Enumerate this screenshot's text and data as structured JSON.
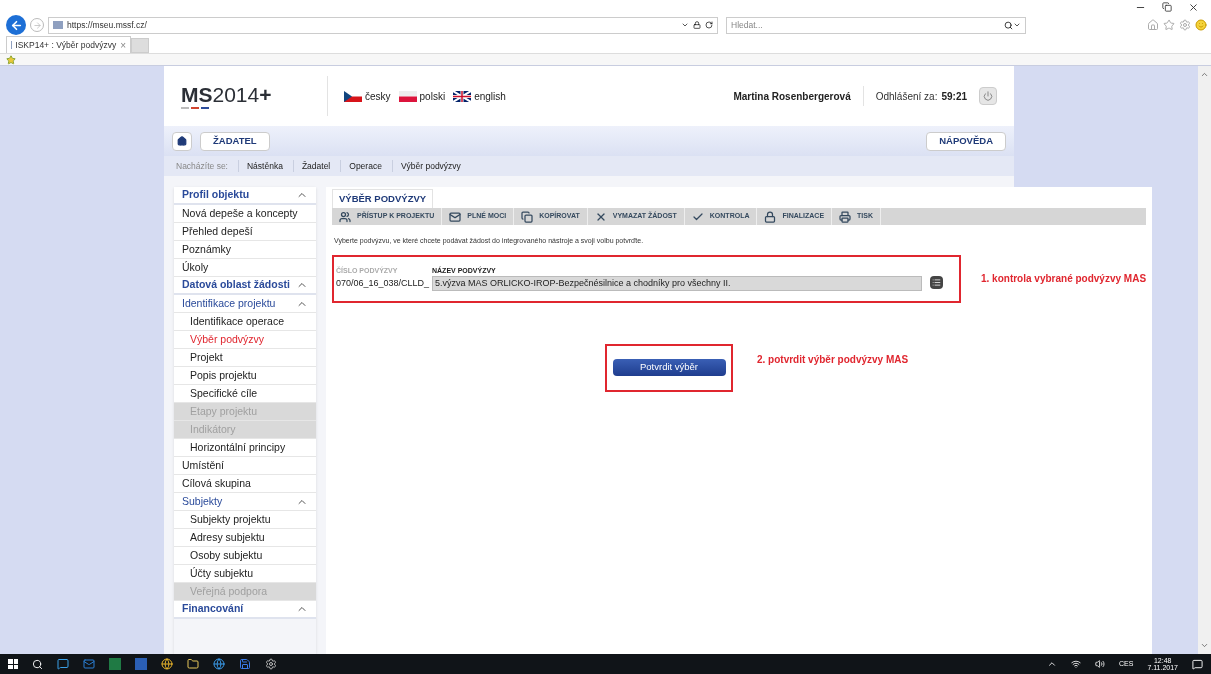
{
  "browser": {
    "url": "https://mseu.mssf.cz/",
    "search_placeholder": "Hledat...",
    "tabs": [
      {
        "title": "ISKP14+ : Výběr podvýzvy",
        "close": "×",
        "selected": true
      }
    ]
  },
  "header": {
    "logo_main": "MS",
    "logo_year": "2014",
    "logo_plus": "+",
    "languages": [
      {
        "label": "česky"
      },
      {
        "label": "polski"
      },
      {
        "label": "english"
      }
    ],
    "user": "Martina Rosenbergerová",
    "logout_label": "Odhlášení za:",
    "logout_time": "59:21"
  },
  "nav": {
    "role": "ŽADATEL",
    "help": "NÁPOVĚDA"
  },
  "breadcrumb": {
    "label": "Nacházíte se:",
    "items": [
      "Nástěnka",
      "Žadatel",
      "Operace",
      "Výběr podvýzvy"
    ]
  },
  "sidebar": [
    {
      "label": "Profil objektu",
      "expanded": true,
      "children": [
        {
          "label": "Nová depeše a koncepty",
          "selected": false,
          "disabled": false
        },
        {
          "label": "Přehled depeší",
          "selected": false,
          "disabled": false
        },
        {
          "label": "Poznámky",
          "selected": false,
          "disabled": false
        },
        {
          "label": "Úkoly",
          "selected": false,
          "disabled": false
        }
      ]
    },
    {
      "label": "Datová oblast žádosti",
      "expanded": true,
      "children": [
        {
          "label": "Identifikace projektu",
          "expanded": true,
          "children": [
            {
              "label": "Identifikace operace",
              "selected": false,
              "disabled": false
            },
            {
              "label": "Výběr podvýzvy",
              "selected": true,
              "disabled": false
            },
            {
              "label": "Projekt",
              "selected": false,
              "disabled": false
            },
            {
              "label": "Popis projektu",
              "selected": false,
              "disabled": false
            },
            {
              "label": "Specifické cíle",
              "selected": false,
              "disabled": false
            },
            {
              "label": "Etapy projektu",
              "selected": false,
              "disabled": true
            },
            {
              "label": "Indikátory",
              "selected": false,
              "disabled": true
            },
            {
              "label": "Horizontální principy",
              "selected": false,
              "disabled": false
            }
          ]
        },
        {
          "label": "Umístění",
          "selected": false,
          "disabled": false
        },
        {
          "label": "Cílová skupina",
          "selected": false,
          "disabled": false
        },
        {
          "label": "Subjekty",
          "expanded": true,
          "children": [
            {
              "label": "Subjekty projektu",
              "selected": false,
              "disabled": false
            },
            {
              "label": "Adresy subjektu",
              "selected": false,
              "disabled": false
            },
            {
              "label": "Osoby subjektu",
              "selected": false,
              "disabled": false
            },
            {
              "label": "Účty subjektu",
              "selected": false,
              "disabled": false
            },
            {
              "label": "Veřejná podpora",
              "selected": false,
              "disabled": true
            }
          ]
        }
      ]
    },
    {
      "label": "Financování",
      "kind": "group",
      "expanded": true
    }
  ],
  "content": {
    "tab": "VÝBĚR PODVÝZVY",
    "toolbar": [
      "PŘÍSTUP K PROJEKTU",
      "PLNÉ MOCI",
      "KOPÍROVAT",
      "VYMAZAT ŽÁDOST",
      "KONTROLA",
      "FINALIZACE",
      "TISK"
    ],
    "instruction": "Vyberte podvýzvu, ve které chcete podávat žádost do integrovaného nástroje a svoji volbu potvrďte.",
    "number_label": "ČÍSLO PODVÝZVY",
    "number_value": "070/06_16_038/CLLD_",
    "name_label": "NÁZEV PODVÝZVY",
    "name_value": "5.výzva MAS ORLICKO-IROP-Bezpečnésilnice a chodníky pro všechny II.",
    "confirm": "Potvrdit výběr"
  },
  "annotations": [
    "1. kontrola vybrané podvýzvy MAS",
    "2. potvrdit výběr podvýzvy MAS"
  ],
  "taskbar": {
    "language": "CES",
    "time": "12:48",
    "date": "7.11.2017"
  }
}
